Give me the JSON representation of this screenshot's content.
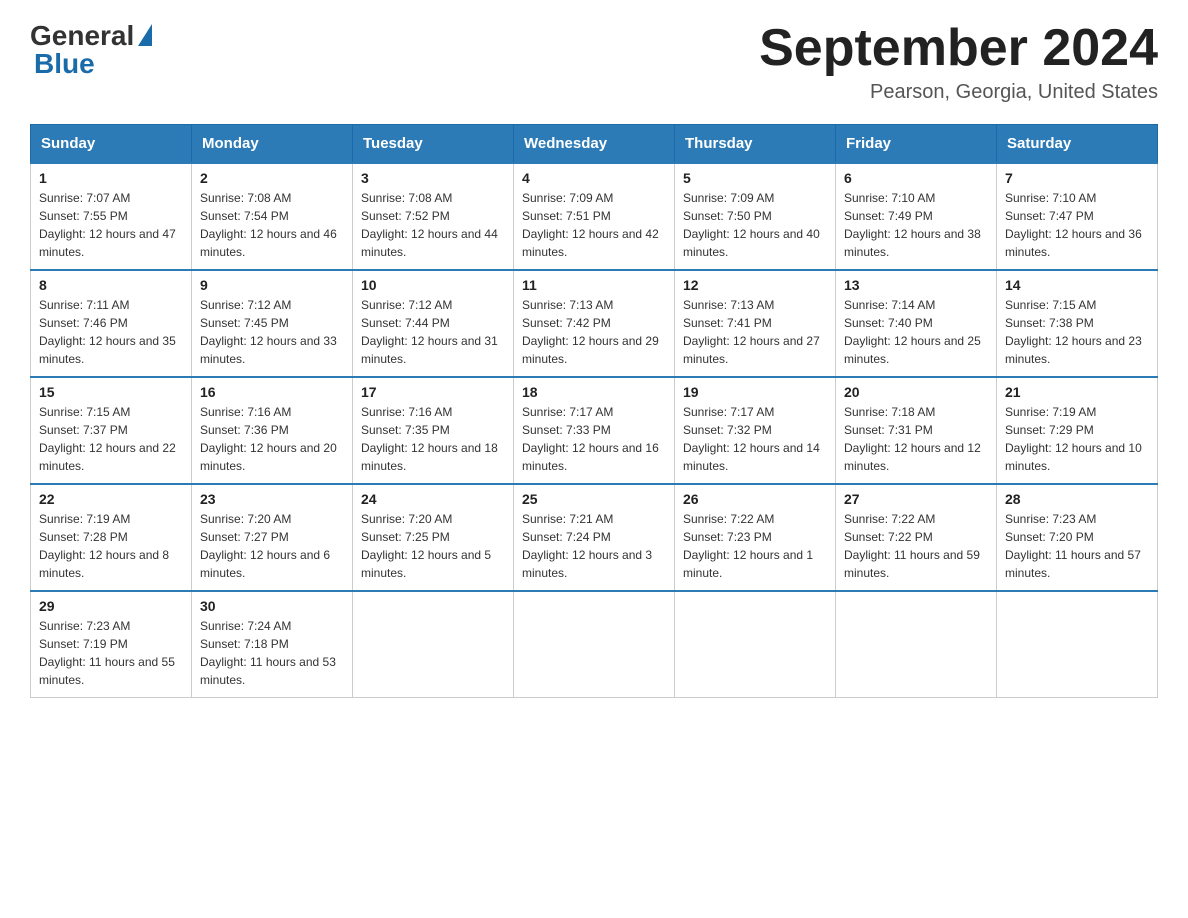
{
  "header": {
    "logo_general": "General",
    "logo_blue": "Blue",
    "title": "September 2024",
    "subtitle": "Pearson, Georgia, United States"
  },
  "weekdays": [
    "Sunday",
    "Monday",
    "Tuesday",
    "Wednesday",
    "Thursday",
    "Friday",
    "Saturday"
  ],
  "weeks": [
    [
      {
        "day": "1",
        "sunrise": "7:07 AM",
        "sunset": "7:55 PM",
        "daylight": "12 hours and 47 minutes."
      },
      {
        "day": "2",
        "sunrise": "7:08 AM",
        "sunset": "7:54 PM",
        "daylight": "12 hours and 46 minutes."
      },
      {
        "day": "3",
        "sunrise": "7:08 AM",
        "sunset": "7:52 PM",
        "daylight": "12 hours and 44 minutes."
      },
      {
        "day": "4",
        "sunrise": "7:09 AM",
        "sunset": "7:51 PM",
        "daylight": "12 hours and 42 minutes."
      },
      {
        "day": "5",
        "sunrise": "7:09 AM",
        "sunset": "7:50 PM",
        "daylight": "12 hours and 40 minutes."
      },
      {
        "day": "6",
        "sunrise": "7:10 AM",
        "sunset": "7:49 PM",
        "daylight": "12 hours and 38 minutes."
      },
      {
        "day": "7",
        "sunrise": "7:10 AM",
        "sunset": "7:47 PM",
        "daylight": "12 hours and 36 minutes."
      }
    ],
    [
      {
        "day": "8",
        "sunrise": "7:11 AM",
        "sunset": "7:46 PM",
        "daylight": "12 hours and 35 minutes."
      },
      {
        "day": "9",
        "sunrise": "7:12 AM",
        "sunset": "7:45 PM",
        "daylight": "12 hours and 33 minutes."
      },
      {
        "day": "10",
        "sunrise": "7:12 AM",
        "sunset": "7:44 PM",
        "daylight": "12 hours and 31 minutes."
      },
      {
        "day": "11",
        "sunrise": "7:13 AM",
        "sunset": "7:42 PM",
        "daylight": "12 hours and 29 minutes."
      },
      {
        "day": "12",
        "sunrise": "7:13 AM",
        "sunset": "7:41 PM",
        "daylight": "12 hours and 27 minutes."
      },
      {
        "day": "13",
        "sunrise": "7:14 AM",
        "sunset": "7:40 PM",
        "daylight": "12 hours and 25 minutes."
      },
      {
        "day": "14",
        "sunrise": "7:15 AM",
        "sunset": "7:38 PM",
        "daylight": "12 hours and 23 minutes."
      }
    ],
    [
      {
        "day": "15",
        "sunrise": "7:15 AM",
        "sunset": "7:37 PM",
        "daylight": "12 hours and 22 minutes."
      },
      {
        "day": "16",
        "sunrise": "7:16 AM",
        "sunset": "7:36 PM",
        "daylight": "12 hours and 20 minutes."
      },
      {
        "day": "17",
        "sunrise": "7:16 AM",
        "sunset": "7:35 PM",
        "daylight": "12 hours and 18 minutes."
      },
      {
        "day": "18",
        "sunrise": "7:17 AM",
        "sunset": "7:33 PM",
        "daylight": "12 hours and 16 minutes."
      },
      {
        "day": "19",
        "sunrise": "7:17 AM",
        "sunset": "7:32 PM",
        "daylight": "12 hours and 14 minutes."
      },
      {
        "day": "20",
        "sunrise": "7:18 AM",
        "sunset": "7:31 PM",
        "daylight": "12 hours and 12 minutes."
      },
      {
        "day": "21",
        "sunrise": "7:19 AM",
        "sunset": "7:29 PM",
        "daylight": "12 hours and 10 minutes."
      }
    ],
    [
      {
        "day": "22",
        "sunrise": "7:19 AM",
        "sunset": "7:28 PM",
        "daylight": "12 hours and 8 minutes."
      },
      {
        "day": "23",
        "sunrise": "7:20 AM",
        "sunset": "7:27 PM",
        "daylight": "12 hours and 6 minutes."
      },
      {
        "day": "24",
        "sunrise": "7:20 AM",
        "sunset": "7:25 PM",
        "daylight": "12 hours and 5 minutes."
      },
      {
        "day": "25",
        "sunrise": "7:21 AM",
        "sunset": "7:24 PM",
        "daylight": "12 hours and 3 minutes."
      },
      {
        "day": "26",
        "sunrise": "7:22 AM",
        "sunset": "7:23 PM",
        "daylight": "12 hours and 1 minute."
      },
      {
        "day": "27",
        "sunrise": "7:22 AM",
        "sunset": "7:22 PM",
        "daylight": "11 hours and 59 minutes."
      },
      {
        "day": "28",
        "sunrise": "7:23 AM",
        "sunset": "7:20 PM",
        "daylight": "11 hours and 57 minutes."
      }
    ],
    [
      {
        "day": "29",
        "sunrise": "7:23 AM",
        "sunset": "7:19 PM",
        "daylight": "11 hours and 55 minutes."
      },
      {
        "day": "30",
        "sunrise": "7:24 AM",
        "sunset": "7:18 PM",
        "daylight": "11 hours and 53 minutes."
      },
      null,
      null,
      null,
      null,
      null
    ]
  ],
  "labels": {
    "sunrise_prefix": "Sunrise: ",
    "sunset_prefix": "Sunset: ",
    "daylight_prefix": "Daylight: "
  }
}
